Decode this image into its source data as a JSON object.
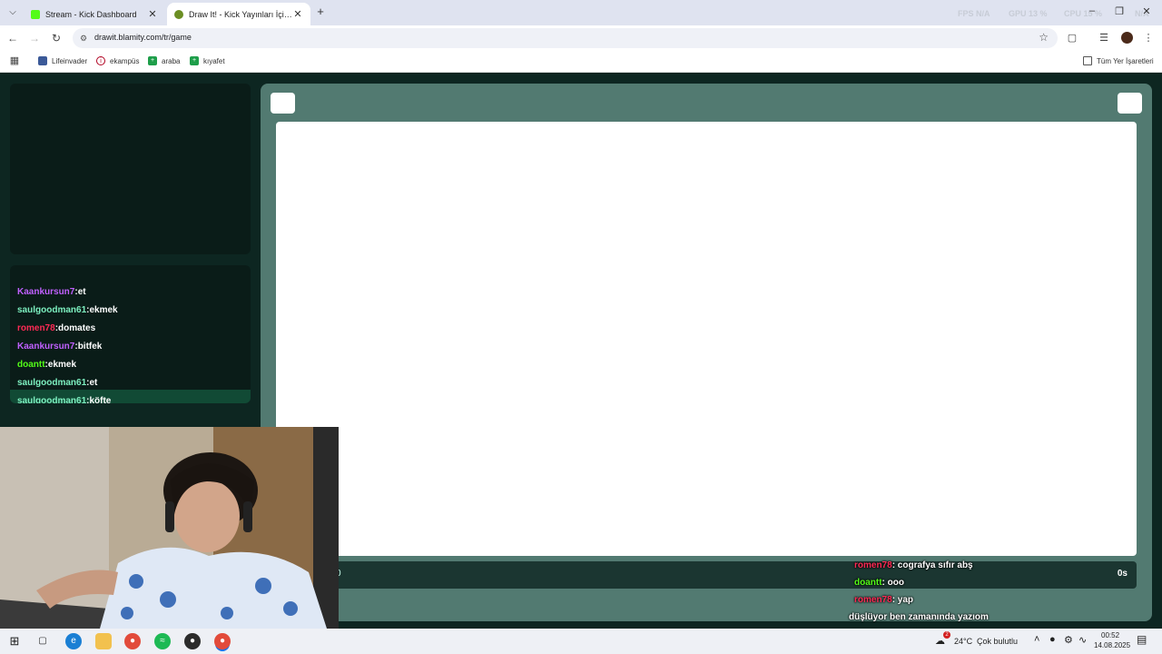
{
  "browser": {
    "tabs": [
      {
        "title": "Stream - Kick Dashboard",
        "active": false,
        "favicon_color": "#53fc18"
      },
      {
        "title": "Draw It! - Kick Yayınları İçin Çizim",
        "active": true,
        "favicon_color": "#6b8e23"
      }
    ],
    "overlay_stats": {
      "fps_label": "FPS",
      "fps_value": "N/A",
      "gpu_label": "GPU",
      "gpu_value": "13 %",
      "cpu_label": "CPU",
      "cpu_value": "15 %",
      "other_label": "",
      "other_value": "N/A"
    },
    "url": "drawit.blamity.com/tr/game",
    "bookmarks": [
      {
        "label": "Lifeinvader",
        "color": "#3b5998"
      },
      {
        "label": "ekampüs",
        "color": "#b00020"
      },
      {
        "label": "araba",
        "color": "#1e9e4a"
      },
      {
        "label": "kıyafet",
        "color": "#1e9e4a"
      }
    ],
    "all_bookmarks_label": "Tüm Yer İşaretleri"
  },
  "game_chat": [
    {
      "user": "Kaankursun7",
      "user_color": "#c060ff",
      "message": ":et"
    },
    {
      "user": "saulgoodman61",
      "user_color": "#7df0c0",
      "message": ":ekmek"
    },
    {
      "user": "romen78",
      "user_color": "#ff2a55",
      "message": ":domates"
    },
    {
      "user": "Kaankursun7",
      "user_color": "#c060ff",
      "message": ":bitfek"
    },
    {
      "user": "doantt",
      "user_color": "#53fc18",
      "message": ":ekmek"
    },
    {
      "user": "saulgoodman61",
      "user_color": "#7df0c0",
      "message": ":et"
    },
    {
      "user": "saulgoodman61",
      "user_color": "#7df0c0",
      "message": ":köfte"
    }
  ],
  "game": {
    "timer": "0s",
    "progress_marker": "0"
  },
  "stream_overlay_chat": [
    {
      "user": "romen78",
      "user_color": "#ff2a55",
      "message": ": cografya sıfır abş"
    },
    {
      "user": "doantt",
      "user_color": "#53fc18",
      "message": ": ooo"
    },
    {
      "user": "romen78",
      "user_color": "#ff2a55",
      "message": ": yap"
    },
    {
      "user": "",
      "user_color": "#ffffff",
      "message": "düşlüyor ben zamanında yazıom"
    }
  ],
  "taskbar": {
    "weather_temp": "24°C",
    "weather_desc": "Çok bulutlu",
    "time": "00:52",
    "date": "14.08.2025",
    "notification_badge": "2"
  }
}
